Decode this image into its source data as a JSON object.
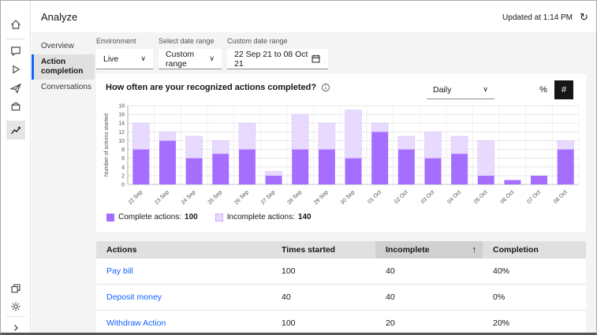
{
  "header": {
    "title": "Analyze",
    "updated_label": "Updated at 1:14 PM",
    "refresh_glyph": "↻"
  },
  "nav": {
    "items": [
      {
        "label": "Overview",
        "selected": false
      },
      {
        "label": "Action completion",
        "selected": true
      },
      {
        "label": "Conversations",
        "selected": false
      }
    ]
  },
  "filters": {
    "environment": {
      "label": "Environment",
      "value": "Live"
    },
    "date_range": {
      "label": "Select date range",
      "value": "Custom range"
    },
    "custom_range": {
      "label": "Custom date range",
      "value": "22 Sep 21 to 08 Oct 21"
    }
  },
  "chart_card": {
    "title": "How often are your recognized actions completed?",
    "interval": "Daily",
    "toggle_percent": "%",
    "toggle_count": "#"
  },
  "chart_data": {
    "type": "bar",
    "stacked": true,
    "title": "How often are your recognized actions completed?",
    "xlabel": "",
    "ylabel": "Number of actions started",
    "ylim": [
      0,
      18
    ],
    "ytick_step": 2,
    "grid": true,
    "legend_position": "bottom-left",
    "categories": [
      "22 Sep",
      "23 Sep",
      "24 Sep",
      "25 Sep",
      "26 Sep",
      "27 Sep",
      "28 Sep",
      "29 Sep",
      "30 Sep",
      "01 Oct",
      "02 Oct",
      "03 Oct",
      "04 Oct",
      "05 Oct",
      "06 Oct",
      "07 Oct",
      "08 Oct"
    ],
    "series": [
      {
        "name": "Complete actions",
        "color": "#a56eff",
        "values": [
          8,
          10,
          6,
          7,
          8,
          2,
          8,
          8,
          6,
          12,
          8,
          6,
          7,
          2,
          1,
          2,
          8
        ]
      },
      {
        "name": "Incomplete actions",
        "color": "#e8daff",
        "values": [
          6,
          2,
          5,
          3,
          6,
          1,
          8,
          6,
          11,
          2,
          3,
          6,
          4,
          8,
          0,
          0,
          2
        ]
      }
    ]
  },
  "legend": {
    "complete_label": "Complete actions:",
    "complete_value": "100",
    "incomplete_label": "Incomplete actions:",
    "incomplete_value": "140"
  },
  "table": {
    "columns": [
      {
        "label": "Actions"
      },
      {
        "label": "Times started"
      },
      {
        "label": "Incomplete",
        "sorted": true,
        "sort_icon": "↑"
      },
      {
        "label": "Completion"
      }
    ],
    "rows": [
      {
        "action": "Pay bill",
        "times_started": "100",
        "incomplete": "40",
        "completion": "40%"
      },
      {
        "action": "Deposit money",
        "times_started": "40",
        "incomplete": "40",
        "completion": "0%"
      },
      {
        "action": "Withdraw Action",
        "times_started": "100",
        "incomplete": "20",
        "completion": "20%"
      }
    ]
  },
  "colors": {
    "accent": "#0f62fe",
    "complete": "#a56eff",
    "incomplete": "#e8daff"
  }
}
